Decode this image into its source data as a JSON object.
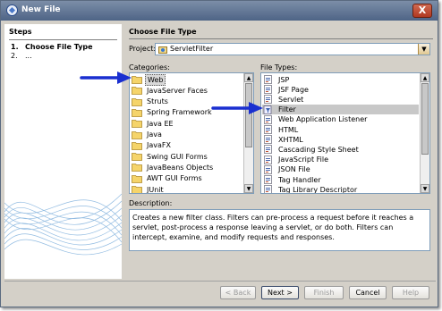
{
  "window": {
    "title": "New File",
    "close_label": "X"
  },
  "steps": {
    "header": "Steps",
    "items": [
      {
        "num": "1.",
        "label": "Choose File Type"
      },
      {
        "num": "2.",
        "label": "..."
      }
    ]
  },
  "main": {
    "header": "Choose File Type",
    "project_label": "Project:",
    "project_value": "ServletFilter",
    "categories_label": "Categories:",
    "filetypes_label": "File Types:",
    "description_label": "Description:",
    "description": "Creates a new filter class. Filters can pre-process a request before it reaches a servlet, post-process a response leaving a servlet, or do both. Filters can intercept, examine, and modify requests and responses."
  },
  "categories": [
    {
      "label": "Web",
      "icon": "folder-icon",
      "selected": true
    },
    {
      "label": "JavaServer Faces",
      "icon": "folder-icon"
    },
    {
      "label": "Struts",
      "icon": "folder-icon"
    },
    {
      "label": "Spring Framework",
      "icon": "folder-icon"
    },
    {
      "label": "Java EE",
      "icon": "folder-icon"
    },
    {
      "label": "Java",
      "icon": "folder-icon"
    },
    {
      "label": "JavaFX",
      "icon": "folder-icon"
    },
    {
      "label": "Swing GUI Forms",
      "icon": "folder-icon"
    },
    {
      "label": "JavaBeans Objects",
      "icon": "folder-icon"
    },
    {
      "label": "AWT GUI Forms",
      "icon": "folder-icon"
    },
    {
      "label": "JUnit",
      "icon": "folder-icon"
    }
  ],
  "file_types": [
    {
      "label": "JSP",
      "icon": "jsp-file-icon"
    },
    {
      "label": "JSF Page",
      "icon": "jsf-page-icon"
    },
    {
      "label": "Servlet",
      "icon": "servlet-icon"
    },
    {
      "label": "Filter",
      "icon": "filter-icon",
      "selected": true
    },
    {
      "label": "Web Application Listener",
      "icon": "listener-icon"
    },
    {
      "label": "HTML",
      "icon": "html-file-icon"
    },
    {
      "label": "XHTML",
      "icon": "xhtml-file-icon"
    },
    {
      "label": "Cascading Style Sheet",
      "icon": "css-file-icon"
    },
    {
      "label": "JavaScript File",
      "icon": "javascript-file-icon"
    },
    {
      "label": "JSON File",
      "icon": "json-file-icon"
    },
    {
      "label": "Tag Handler",
      "icon": "tag-handler-icon"
    },
    {
      "label": "Tag Library Descriptor",
      "icon": "tag-library-icon"
    }
  ],
  "buttons": {
    "back": "< Back",
    "next": "Next >",
    "finish": "Finish",
    "cancel": "Cancel",
    "help": "Help"
  },
  "colors": {
    "title_bar": "#5b7096",
    "selection": "#c8c8c8",
    "arrow": "#1a2fd0"
  }
}
